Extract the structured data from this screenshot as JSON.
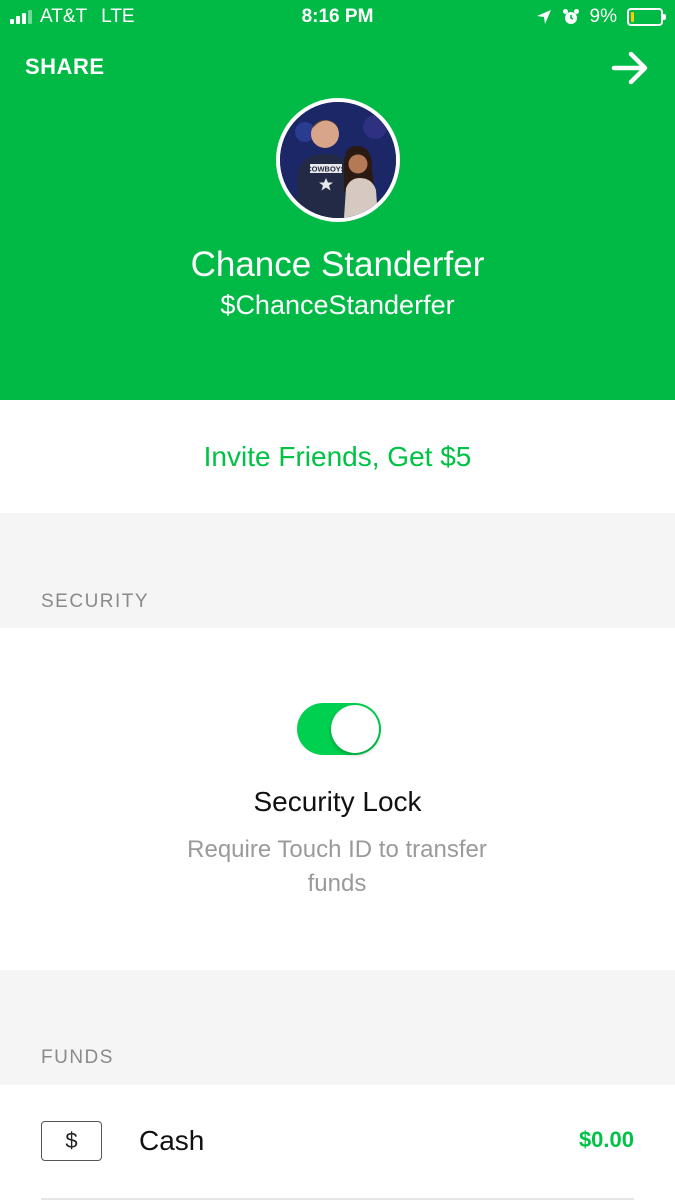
{
  "status_bar": {
    "carrier": "AT&T",
    "network": "LTE",
    "time": "8:16 PM",
    "battery_text": "9%",
    "battery_level": 0.09,
    "signal_bars": 3
  },
  "header": {
    "share_label": "SHARE",
    "name": "Chance Standerfer",
    "cashtag": "$ChanceStanderfer",
    "background_color": "#00ba45"
  },
  "invite": {
    "label": "Invite Friends, Get $5"
  },
  "security": {
    "section_label": "SECURITY",
    "title": "Security Lock",
    "description": "Require Touch ID to transfer funds",
    "toggle_on": true
  },
  "funds": {
    "section_label": "FUNDS",
    "items": [
      {
        "icon_text": "$",
        "label": "Cash",
        "amount": "$0.00"
      }
    ]
  },
  "colors": {
    "accent": "#00c244",
    "toggle": "#00d050"
  }
}
